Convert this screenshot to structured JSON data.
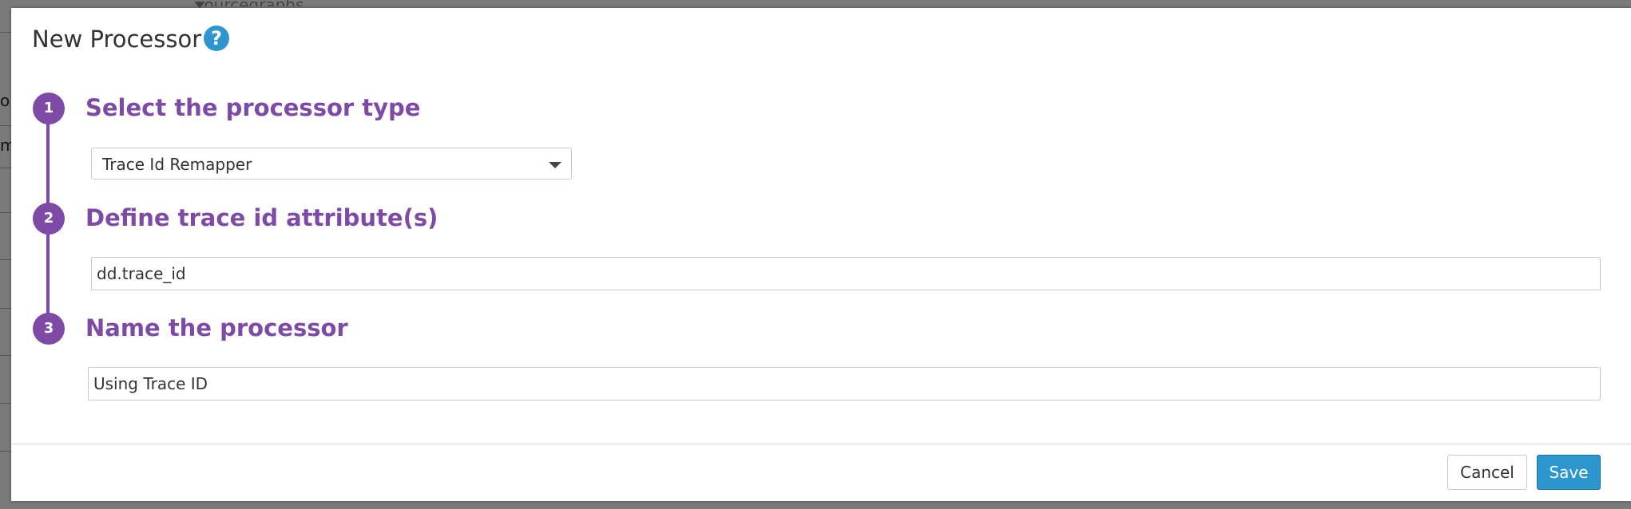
{
  "background": {
    "top_text": "sourcegraphs",
    "left_fragments": [
      "on",
      "ma"
    ]
  },
  "modal": {
    "title": "New Processor",
    "help_icon": "question-mark-icon",
    "help_glyph": "?"
  },
  "steps": [
    {
      "number": "1",
      "title": "Select the processor type"
    },
    {
      "number": "2",
      "title": "Define trace id attribute(s)"
    },
    {
      "number": "3",
      "title": "Name the processor"
    }
  ],
  "processor_type": {
    "selected": "Trace Id Remapper"
  },
  "trace_id_attribute": {
    "value": "dd.trace_id"
  },
  "processor_name": {
    "value": "Using Trace ID"
  },
  "footer": {
    "cancel_label": "Cancel",
    "save_label": "Save"
  },
  "colors": {
    "accent_purple": "#7d4aa6",
    "primary_blue": "#2e96cf"
  }
}
